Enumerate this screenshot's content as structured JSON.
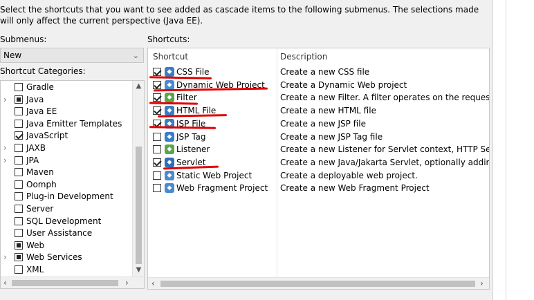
{
  "intro_text": "Select the shortcuts that you want to see added as cascade items to the following submenus. The selections made will only affect the current perspective (Java EE).",
  "submenus_label": "Submenus:",
  "submenu_selected": "New",
  "categories_label": "Shortcut Categories:",
  "shortcuts_label": "Shortcuts:",
  "categories": [
    {
      "label": "Gradle",
      "expandable": false,
      "state": "unchecked"
    },
    {
      "label": "Java",
      "expandable": true,
      "state": "partial"
    },
    {
      "label": "Java EE",
      "expandable": false,
      "state": "unchecked"
    },
    {
      "label": "Java Emitter Templates",
      "expandable": false,
      "state": "unchecked"
    },
    {
      "label": "JavaScript",
      "expandable": false,
      "state": "checked"
    },
    {
      "label": "JAXB",
      "expandable": true,
      "state": "unchecked"
    },
    {
      "label": "JPA",
      "expandable": true,
      "state": "unchecked"
    },
    {
      "label": "Maven",
      "expandable": false,
      "state": "unchecked"
    },
    {
      "label": "Oomph",
      "expandable": false,
      "state": "unchecked"
    },
    {
      "label": "Plug-in Development",
      "expandable": false,
      "state": "unchecked"
    },
    {
      "label": "Server",
      "expandable": false,
      "state": "unchecked"
    },
    {
      "label": "SQL Development",
      "expandable": false,
      "state": "unchecked"
    },
    {
      "label": "User Assistance",
      "expandable": false,
      "state": "unchecked"
    },
    {
      "label": "Web",
      "expandable": false,
      "state": "partial"
    },
    {
      "label": "Web Services",
      "expandable": true,
      "state": "partial"
    },
    {
      "label": "XML",
      "expandable": false,
      "state": "unchecked"
    }
  ],
  "table": {
    "col_shortcut": "Shortcut",
    "col_description": "Description",
    "rows": [
      {
        "name": "CSS File",
        "desc": "Create a new CSS file",
        "checked": true,
        "icon": "css-file-icon",
        "color": "#3b7dc4"
      },
      {
        "name": "Dynamic Web Project",
        "desc": "Create a Dynamic Web project",
        "checked": true,
        "icon": "web-project-icon",
        "color": "#4a8ad0"
      },
      {
        "name": "Filter",
        "desc": "Create a new Filter. A filter operates on the request to a r",
        "checked": true,
        "icon": "filter-icon",
        "color": "#5aa54a"
      },
      {
        "name": "HTML File",
        "desc": "Create a new HTML file",
        "checked": true,
        "icon": "html-file-icon",
        "color": "#3b7dc4"
      },
      {
        "name": "JSP File",
        "desc": "Create a new JSP file",
        "checked": true,
        "icon": "jsp-file-icon",
        "color": "#3b7dc4"
      },
      {
        "name": "JSP Tag",
        "desc": "Create a new JSP Tag file",
        "checked": false,
        "icon": "jsp-tag-icon",
        "color": "#3b7dc4"
      },
      {
        "name": "Listener",
        "desc": "Create a new Listener for Servlet context, HTTP Session, o",
        "checked": false,
        "icon": "listener-icon",
        "color": "#5aa54a"
      },
      {
        "name": "Servlet",
        "desc": "Create a new Java/Jakarta Servlet, optionally adding it to",
        "checked": true,
        "icon": "servlet-icon",
        "color": "#2f6db5"
      },
      {
        "name": "Static Web Project",
        "desc": "Create a deployable web project.",
        "checked": false,
        "icon": "static-web-project-icon",
        "color": "#4a8ad0"
      },
      {
        "name": "Web Fragment Project",
        "desc": "Create a new Web Fragment Project",
        "checked": false,
        "icon": "web-fragment-project-icon",
        "color": "#4a8ad0"
      }
    ]
  }
}
